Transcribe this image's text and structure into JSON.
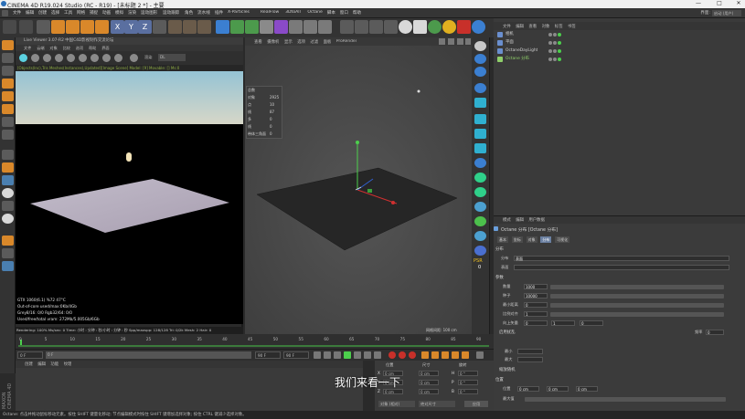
{
  "window": {
    "title": "CINEMA 4D R19.024 Studio (RC - R19) - [未标题 2 *] - 主要",
    "controls": [
      "—",
      "□",
      "✕"
    ]
  },
  "menubar": {
    "items": [
      "文件",
      "编辑",
      "创建",
      "选择",
      "工具",
      "网格",
      "捕捉",
      "动画",
      "模拟",
      "渲染",
      "运动图形",
      "运动跟踪",
      "角色",
      "流水线",
      "插件",
      "X-Particles",
      "RealFlow",
      "3DtoAll",
      "Octane",
      "脚本",
      "窗口",
      "帮助"
    ],
    "layout_label": "界面:",
    "layout_value": "启动 (用户)"
  },
  "liveviewer": {
    "title": "Live Viewer 3.07-R2 中国C4D影视制作交流论坛",
    "menu": [
      "文件",
      "云端",
      "对象",
      "比较",
      "选项",
      "帮助",
      "界面"
    ],
    "mode_select": "DL",
    "info": "[Objects(Inc),Tris Meshes(Instances),Updated][Image Scene] Model: [9] Movable: [] Ms:0",
    "stats": [
      "GTX 1060(6.1)       %72    47°C",
      "Out-of-core used/max:0Kb/4Gb",
      "Grey8/16: 0/0        Rgb32/64: 0/0",
      "Used/free/total vram: 272Mb/5.005Gb/6Gb"
    ],
    "bar": "Rendering: 100%   Ms/sec: 0   Time: 小时 : 分钟 : 秒/小时 : 分钟 : 秒   Spp/maxspp: 128/128   Tri: 0/2k   Mesh: 2   Hair: 0"
  },
  "viewport": {
    "menu": [
      "查看",
      "摄像机",
      "显示",
      "选项",
      "过滤",
      "面板",
      "ProRender"
    ],
    "label": "透视视图",
    "stats": [
      {
        "k": "总数",
        "v": ""
      },
      {
        "k": "对象",
        "v": "2925"
      },
      {
        "k": "点",
        "v": "10"
      },
      {
        "k": "线",
        "v": "87"
      },
      {
        "k": "多",
        "v": "0"
      },
      {
        "k": "线",
        "v": "0"
      },
      {
        "k": "带体三角面",
        "v": "0"
      }
    ],
    "grid": "网格间距: 100 cm"
  },
  "object_manager": {
    "menu": [
      "文件",
      "编辑",
      "查看",
      "对象",
      "标签",
      "书签"
    ],
    "objects": [
      {
        "name": "相机",
        "color": "#6a8fcf"
      },
      {
        "name": "平面",
        "color": "#6a8fcf"
      },
      {
        "name": "OctaneDayLight",
        "color": "#6a8fcf"
      },
      {
        "name": "Octane 分布",
        "color": "#8fcf6a"
      }
    ]
  },
  "attributes": {
    "menu": [
      "模式",
      "编辑",
      "用户数据"
    ],
    "title": "Octane 分布 [Octane 分布]",
    "tabs": [
      "基本",
      "坐标",
      "对象",
      "分布",
      "可视化"
    ],
    "active_tab": 3,
    "section_main": "分布",
    "rows": [
      {
        "label": "分布",
        "value": "表面"
      },
      {
        "label": "表面",
        "value": ""
      }
    ],
    "section_params": "参数",
    "params": [
      {
        "label": "数量",
        "value": "1000"
      },
      {
        "label": "种子",
        "value": "10000"
      },
      {
        "label": "最小距离",
        "value": "0"
      },
      {
        "label": "比例对齐",
        "value": "1"
      },
      {
        "label": "向上矢量",
        "value": "0",
        "extra": [
          "1",
          "0"
        ]
      }
    ],
    "section_anim": "启用扰乱",
    "anim_label": "频率",
    "anim_value": "0",
    "anim_label2": "最小",
    "anim_label3": "最大",
    "section_scale": "缩放随机",
    "section_pos": "位置",
    "pos_label": "位置",
    "pos_values": [
      "0 cm",
      "0 cm",
      "0 cm"
    ],
    "pos_label2": "最大值"
  },
  "timeline": {
    "ticks": [
      "0",
      "5",
      "10",
      "15",
      "20",
      "25",
      "30",
      "35",
      "40",
      "45",
      "50",
      "55",
      "60",
      "65",
      "70",
      "75",
      "80",
      "85",
      "90"
    ],
    "start": "0 F",
    "current": "0 F",
    "end": "90 F",
    "end2": "90 F"
  },
  "material_manager": {
    "menu": [
      "创建",
      "编辑",
      "功能",
      "纹理"
    ]
  },
  "coordinates": {
    "headers": [
      "位置",
      "尺寸",
      "旋转"
    ],
    "rows": [
      {
        "axis": "X",
        "pos": "0 cm",
        "size": "0 cm",
        "rot": "H",
        "rot_val": "0 °"
      },
      {
        "axis": "Y",
        "pos": "0 cm",
        "size": "0 cm",
        "rot": "P",
        "rot_val": "0 °"
      },
      {
        "axis": "Z",
        "pos": "0 cm",
        "size": "0 cm",
        "rot": "B",
        "rot_val": "0 °"
      }
    ],
    "mode1": "对象 (相对)",
    "mode2": "绝对尺寸",
    "apply": "应用"
  },
  "subtitle": "我们来看一下",
  "statusbar": "Octane:  点击并拖动鼠标移动元素。按住 SHIFT 键量化移动; 节点编辑模式时按住 SHIFT 键增加选择对象; 按住 CTRL 键减少选择对象。",
  "colors": {
    "accent_blue": "#3b7fd1",
    "active_tab": "#6a7fa0",
    "green_info": "#8fae45"
  }
}
